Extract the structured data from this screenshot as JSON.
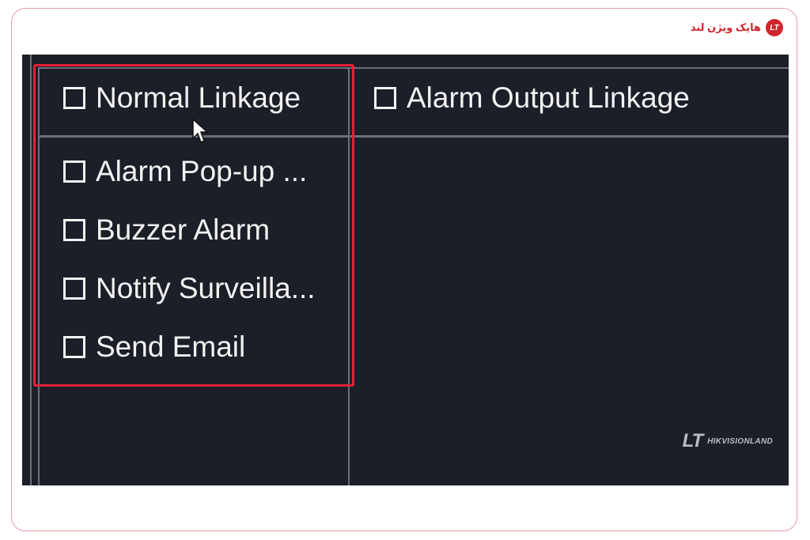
{
  "brand": {
    "logo_icon": "hikvisionland-logo-icon",
    "badge_text": "LT",
    "name": "هایک ویژن لند"
  },
  "linkage": {
    "normal_linkage": {
      "label": "Normal Linkage",
      "checked": false,
      "items": [
        {
          "label": "Alarm Pop-up ...",
          "checked": false
        },
        {
          "label": "Buzzer Alarm",
          "checked": false
        },
        {
          "label": "Notify Surveilla...",
          "checked": false
        },
        {
          "label": "Send Email",
          "checked": false
        }
      ]
    },
    "alarm_output_linkage": {
      "label": "Alarm Output Linkage",
      "checked": false
    }
  },
  "watermark": {
    "logo": "LT",
    "text": "HIKVISIONLAND"
  },
  "colors": {
    "panel_bg": "#1c1f28",
    "highlight": "#e3203a",
    "brand": "#d0252d"
  }
}
